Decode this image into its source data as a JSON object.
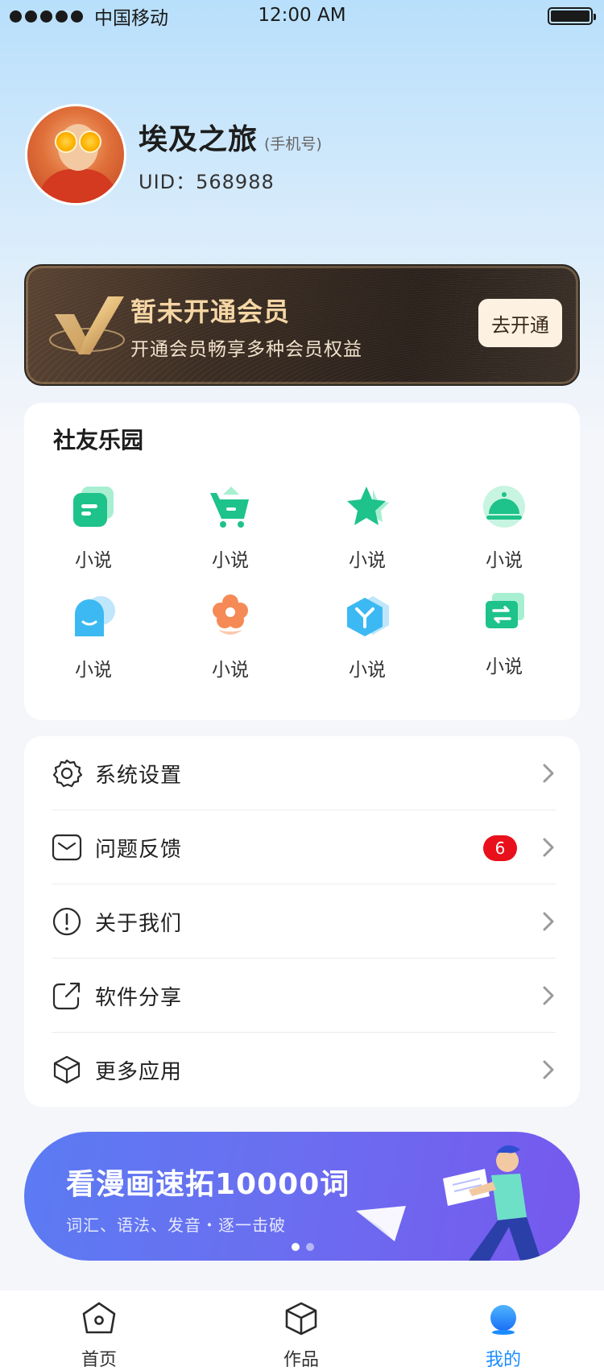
{
  "status_bar": {
    "carrier": "中国移动",
    "time": "12:00 AM"
  },
  "profile": {
    "name": "埃及之旅",
    "phone_hint": "(手机号)",
    "uid": "UID：568988"
  },
  "vip": {
    "title": "暂未开通会员",
    "subtitle": "开通会员畅享多种会员权益",
    "button": "去开通"
  },
  "community": {
    "title": "社友乐园",
    "items": [
      {
        "label": "小说",
        "icon": "chat-bubble-icon",
        "color": "#1ec28b"
      },
      {
        "label": "小说",
        "icon": "shopping-cart-icon",
        "color": "#1ec28b"
      },
      {
        "label": "小说",
        "icon": "star-icon",
        "color": "#1ec28b"
      },
      {
        "label": "小说",
        "icon": "service-bell-icon",
        "color": "#1ec28b"
      },
      {
        "label": "小说",
        "icon": "user-chat-icon",
        "color": "#3cb9f2"
      },
      {
        "label": "小说",
        "icon": "flower-icon",
        "color": "#f58a56"
      },
      {
        "label": "小说",
        "icon": "hexagon-y-icon",
        "color": "#3cb9f2"
      },
      {
        "label": "小说",
        "icon": "exchange-ticket-icon",
        "color": "#1ec28b"
      }
    ]
  },
  "menu": {
    "items": [
      {
        "label": "系统设置",
        "icon": "gear-icon"
      },
      {
        "label": "问题反馈",
        "icon": "mail-icon",
        "badge": "6"
      },
      {
        "label": "关于我们",
        "icon": "info-circle-icon"
      },
      {
        "label": "软件分享",
        "icon": "share-icon"
      },
      {
        "label": "更多应用",
        "icon": "cube-icon"
      }
    ]
  },
  "promo": {
    "title": "看漫画速拓10000词",
    "subtitle": "词汇、语法、发音・逐一击破"
  },
  "tab_bar": {
    "tabs": [
      {
        "label": "首页",
        "icon": "home-icon"
      },
      {
        "label": "作品",
        "icon": "box-icon"
      },
      {
        "label": "我的",
        "icon": "profile-dot-icon",
        "active": true
      }
    ]
  },
  "colors": {
    "accent": "#1a8cff",
    "green": "#1ec28b",
    "badge": "#e8101a",
    "vip_gold": "#f5d6a5"
  }
}
